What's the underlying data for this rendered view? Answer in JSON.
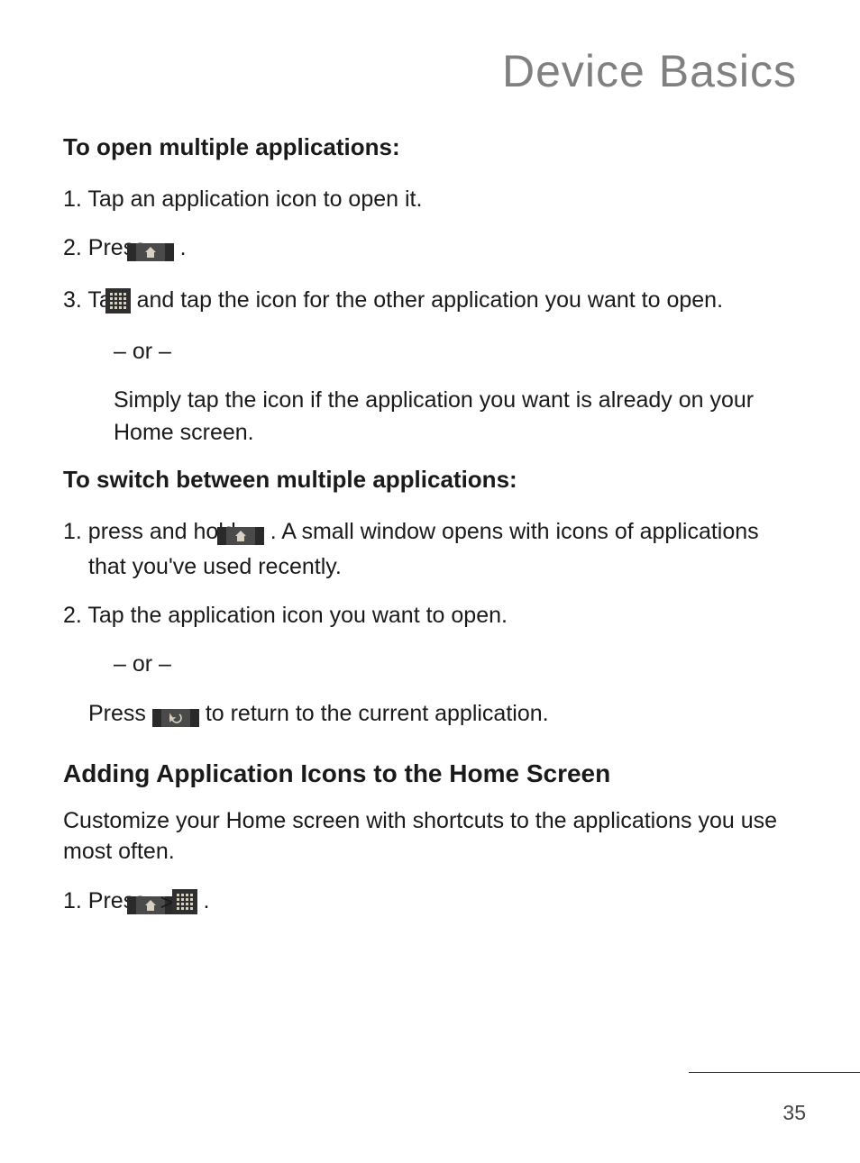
{
  "page": {
    "title": "Device Basics",
    "number": "35"
  },
  "sections": {
    "sub1": "To open multiple applications:",
    "step1": "1. Tap an application icon to open it.",
    "step2_a": "2. Press ",
    "step2_b": " .",
    "step3_a": "3. Tap ",
    "step3_b": " and tap the icon for the other application you want to open.",
    "or1": "– or –",
    "step3_c": "Simply tap the icon if the application you want is already on your Home screen.",
    "sub2": "To switch between multiple applications:",
    "step4_a": "1. press and hold ",
    "step4_b": " . A small window opens with icons of applications that you've used recently.",
    "step5": "2. Tap the application icon you want to open.",
    "or2": "– or –",
    "step6_a": "Press ",
    "step6_b": " to return to the current application.",
    "head1": "Adding Application Icons to the Home Screen",
    "para1": "Customize your Home screen with shortcuts to the applications you use most often.",
    "step7_a": "1. Press ",
    "sep": ">",
    "step7_b": " ."
  },
  "icons": {
    "home": "home-icon",
    "apps": "apps-icon",
    "back": "back-icon"
  }
}
